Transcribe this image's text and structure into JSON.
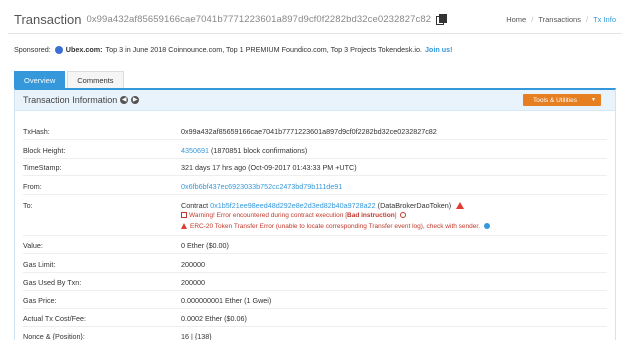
{
  "header": {
    "title": "Transaction",
    "tx_hash": "0x99a432af85659166cae7041b7771223601a897d9cf0f2282bd32ce0232827c82"
  },
  "breadcrumb": {
    "home": "Home",
    "transactions": "Transactions",
    "current": "Tx Info"
  },
  "sponsor": {
    "prefix": "Sponsored:",
    "brand": "Ubex.com:",
    "text": "Top 3 in June 2018 Coinnounce.com, Top 1 PREMIUM Foundico.com, Top 3 Projects Tokendesk.io.",
    "cta": "Join us!"
  },
  "tabs": [
    {
      "label": "Overview",
      "active": true
    },
    {
      "label": "Comments",
      "active": false
    }
  ],
  "panel": {
    "title": "Transaction Information",
    "tools_label": "Tools & Utilities"
  },
  "rows": {
    "txhash": {
      "label": "TxHash:",
      "value": "0x99a432af85659166cae7041b7771223601a897d9cf0f2282bd32ce0232827c82"
    },
    "block": {
      "label": "Block Height:",
      "value": "4350691",
      "confirmations": "(1870851 block confirmations)"
    },
    "timestamp": {
      "label": "TimeStamp:",
      "value": "321 days 17 hrs ago (Oct-09-2017 01:43:33 PM +UTC)"
    },
    "from": {
      "label": "From:",
      "value": "0x6fb6bf437ec6923033b752cc2473bd79b111de91"
    },
    "to": {
      "label": "To:",
      "prefix": "Contract",
      "address": "0x1b5f21ee98eed48d292e8e2d3ed82b40a9728a22",
      "name": "(DataBrokerDaoToken)",
      "warning_pre": "Warning! Error encountered during contract execution [",
      "warning_bold": "Bad instruction",
      "warning_post": "]",
      "erc_warning": "ERC-20 Token Transfer Error (unable to locate corresponding Transfer event log), check with sender."
    },
    "value": {
      "label": "Value:",
      "value": "0 Ether ($0.00)"
    },
    "gas_limit": {
      "label": "Gas Limit:",
      "value": "200000"
    },
    "gas_used": {
      "label": "Gas Used By Txn:",
      "value": "200000"
    },
    "gas_price": {
      "label": "Gas Price:",
      "value": "0.000000001 Ether (1 Gwei)"
    },
    "cost": {
      "label": "Actual Tx Cost/Fee:",
      "value": "0.0002 Ether ($0.06)"
    },
    "nonce": {
      "label": "Nonce & {Position}:",
      "value": "16 | {138}"
    }
  },
  "colors": {
    "accent": "#3498db",
    "tools": "#e67e22",
    "error": "#c0392b"
  }
}
